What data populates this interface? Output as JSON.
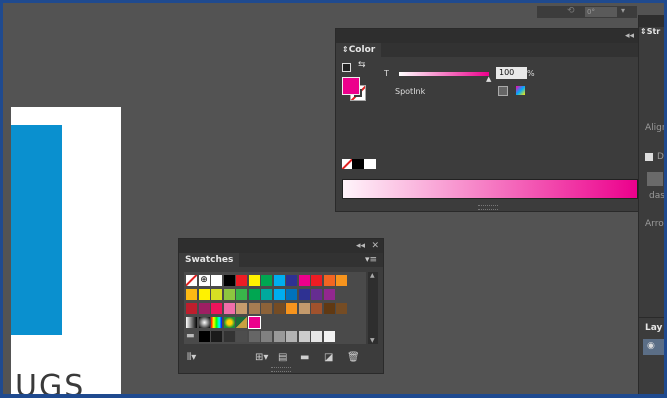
{
  "top_strip": {
    "zoom_value": "0°"
  },
  "color_panel": {
    "tab_label": "Color",
    "t_label": "T",
    "tint_value": "100",
    "percent_label": "%",
    "swatch_name": "SpotInk",
    "tint_fraction": 1.0,
    "fill_color": "#ec008c"
  },
  "swatches_panel": {
    "tab_label": "Swatches",
    "grid_colors": [
      [
        "none",
        "registration",
        "#ffffff",
        "#000000",
        "#ed1c24",
        "#fff200",
        "#00a651",
        "#00aeef",
        "#2e3192",
        "#ec008c",
        "#ed1c24",
        "#f26522",
        "#f7941d"
      ],
      [
        "#fdb913",
        "#fff200",
        "#d7df23",
        "#8dc63f",
        "#39b54a",
        "#00a651",
        "#00a99d",
        "#00aeef",
        "#0072bc",
        "#2e3192",
        "#662d91",
        "#92278f"
      ],
      [
        "#be1e2d",
        "#9e1f63",
        "#ed145b",
        "#f06eaa",
        "#c69c6d",
        "#a67c52",
        "#8c6239",
        "#754c24",
        "#f7941d",
        "#c49a6c",
        "#a0522d",
        "#603913",
        "#754c24"
      ],
      [
        "gradient-gray",
        "gradient-radial",
        "gradient-rainbow",
        "group-a",
        "group-b",
        "spot-selected"
      ],
      [
        "folder",
        "#000000",
        "#1a1a1a",
        "#333333",
        "#4d4d4d",
        "#666666",
        "#808080",
        "#999999",
        "#b3b3b3",
        "#cccccc",
        "#e6e6e6",
        "#f2f2f2"
      ]
    ]
  },
  "right_panel": {
    "tab_label": "Str",
    "align_label": "Align",
    "d_label": "D",
    "dash_label": "dash",
    "arrow_label": "Arro",
    "layers_label": "Lay"
  }
}
